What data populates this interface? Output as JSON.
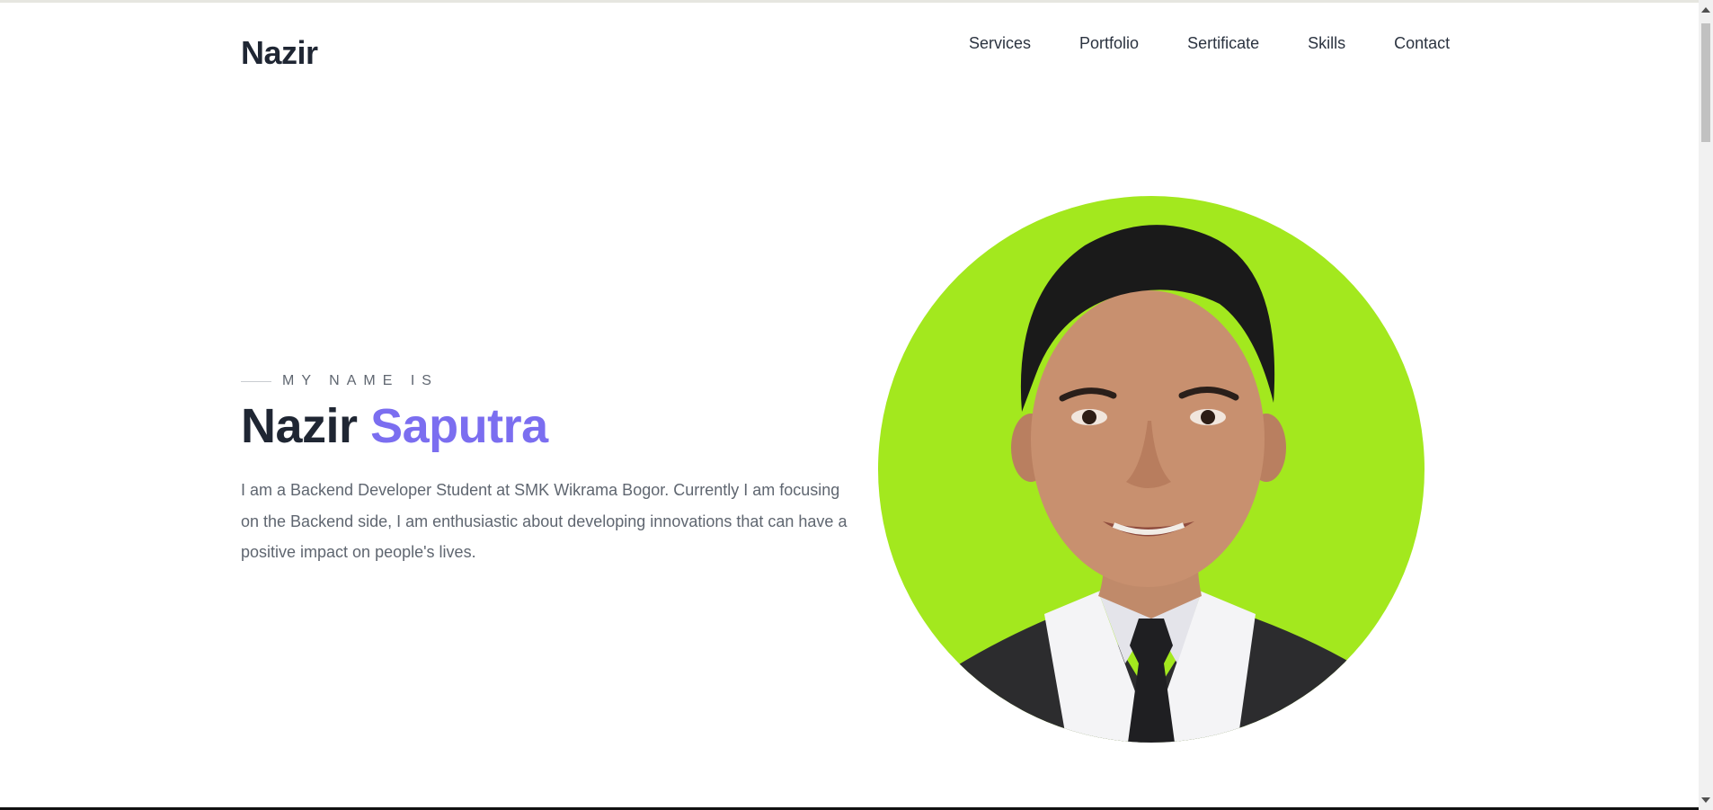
{
  "header": {
    "brand": "Nazir",
    "nav": [
      "Services",
      "Portfolio",
      "Sertificate",
      "Skills",
      "Contact"
    ]
  },
  "hero": {
    "eyebrow": "MY NAME IS",
    "first_name": "Nazir",
    "last_name": "Saputra",
    "description": "I am a Backend Developer Student at SMK Wikrama Bogor. Currently I am focusing on the Backend side, I am enthusiastic about developing innovations that can have a positive impact on people's lives."
  },
  "colors": {
    "accent": "#7b6ef0",
    "heading": "#1f2633",
    "portrait_background": "#a3e81e"
  },
  "icons": [
    "portrait-photo"
  ]
}
